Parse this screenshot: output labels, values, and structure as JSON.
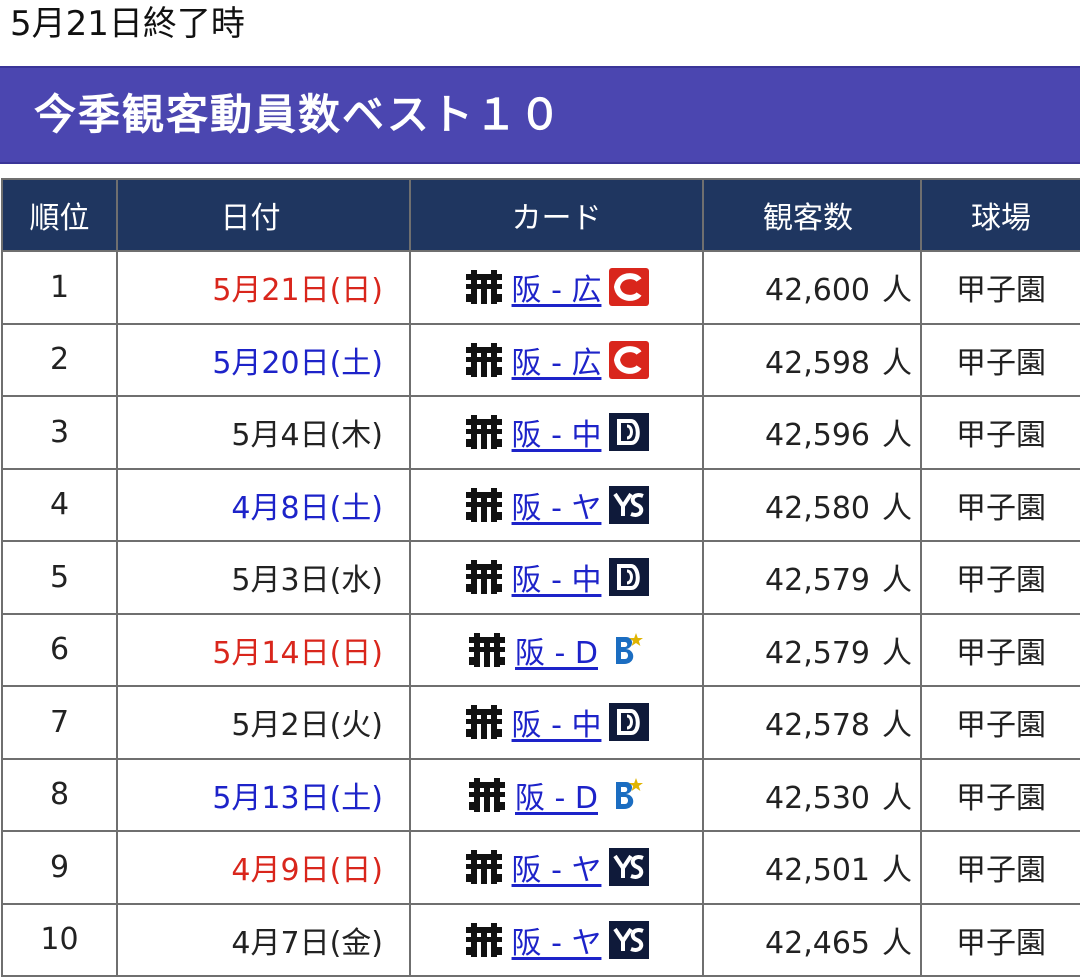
{
  "top_note": "5月21日終了時",
  "header": {
    "title": "今季観客動員数ベスト１０"
  },
  "table": {
    "columns": [
      "順位",
      "日付",
      "カード",
      "観客数",
      "球場"
    ],
    "rows": [
      {
        "rank": "1",
        "date": "5月21日(日)",
        "day_type": "sun",
        "card": "阪 - 広",
        "home_icon": "tigers-logo-icon",
        "away_icon": "carp-logo-icon",
        "attendance": "42,600",
        "unit": "人",
        "stadium": "甲子園"
      },
      {
        "rank": "2",
        "date": "5月20日(土)",
        "day_type": "sat",
        "card": "阪 - 広",
        "home_icon": "tigers-logo-icon",
        "away_icon": "carp-logo-icon",
        "attendance": "42,598",
        "unit": "人",
        "stadium": "甲子園"
      },
      {
        "rank": "3",
        "date": "5月4日(木)",
        "day_type": "wk",
        "card": "阪 - 中",
        "home_icon": "tigers-logo-icon",
        "away_icon": "dragons-logo-icon",
        "attendance": "42,596",
        "unit": "人",
        "stadium": "甲子園"
      },
      {
        "rank": "4",
        "date": "4月8日(土)",
        "day_type": "sat",
        "card": "阪 - ヤ",
        "home_icon": "tigers-logo-icon",
        "away_icon": "swallows-logo-icon",
        "attendance": "42,580",
        "unit": "人",
        "stadium": "甲子園"
      },
      {
        "rank": "5",
        "date": "5月3日(水)",
        "day_type": "wk",
        "card": "阪 - 中",
        "home_icon": "tigers-logo-icon",
        "away_icon": "dragons-logo-icon",
        "attendance": "42,579",
        "unit": "人",
        "stadium": "甲子園"
      },
      {
        "rank": "6",
        "date": "5月14日(日)",
        "day_type": "sun",
        "card": "阪 - D",
        "home_icon": "tigers-logo-icon",
        "away_icon": "baystars-logo-icon",
        "attendance": "42,579",
        "unit": "人",
        "stadium": "甲子園"
      },
      {
        "rank": "7",
        "date": "5月2日(火)",
        "day_type": "wk",
        "card": "阪 - 中",
        "home_icon": "tigers-logo-icon",
        "away_icon": "dragons-logo-icon",
        "attendance": "42,578",
        "unit": "人",
        "stadium": "甲子園"
      },
      {
        "rank": "8",
        "date": "5月13日(土)",
        "day_type": "sat",
        "card": "阪 - D",
        "home_icon": "tigers-logo-icon",
        "away_icon": "baystars-logo-icon",
        "attendance": "42,530",
        "unit": "人",
        "stadium": "甲子園"
      },
      {
        "rank": "9",
        "date": "4月9日(日)",
        "day_type": "sun",
        "card": "阪 - ヤ",
        "home_icon": "tigers-logo-icon",
        "away_icon": "swallows-logo-icon",
        "attendance": "42,501",
        "unit": "人",
        "stadium": "甲子園"
      },
      {
        "rank": "10",
        "date": "4月7日(金)",
        "day_type": "wk",
        "card": "阪 - ヤ",
        "home_icon": "tigers-logo-icon",
        "away_icon": "swallows-logo-icon",
        "attendance": "42,465",
        "unit": "人",
        "stadium": "甲子園"
      }
    ]
  },
  "colors": {
    "header_bg": "#4b46b0",
    "table_head_bg": "#1f3660",
    "sunday": "#d9261c",
    "saturday": "#1d23c9",
    "link": "#1d23c9"
  }
}
